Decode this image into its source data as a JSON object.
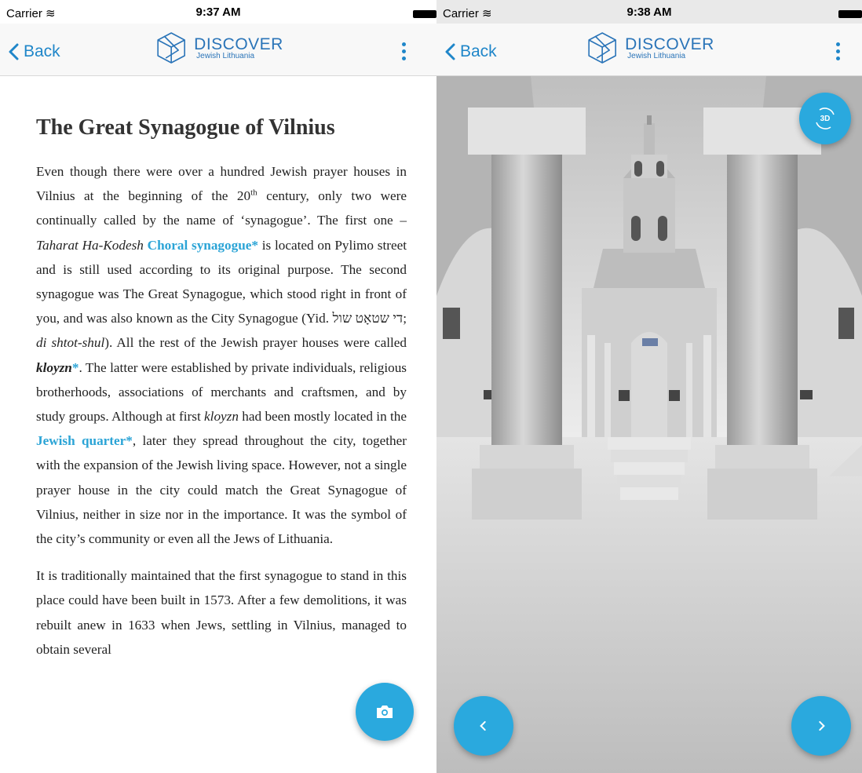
{
  "left": {
    "status": {
      "carrier": "Carrier",
      "time": "9:37 AM"
    },
    "nav": {
      "back_label": "Back",
      "logo_title": "DISCOVER",
      "logo_subtitle": "Jewish Lithuania"
    },
    "article": {
      "title": "The Great Synagogue of Vilnius",
      "p1": {
        "s1": "Even though there were over a hundred Jewish prayer houses in Vilnius at the beginning of the 20",
        "sup": "th",
        "s2": " century, only two were continually called by the name of ‘synagogue’. The first one – ",
        "italic1": "Taharat Ha-Kodesh",
        "link1": "Choral synagogue*",
        "s3": " is located on Pylimo street and is still used according to its original purpose. The second synagogue was The Great Synagogue, which stood right in front of you, and was also known as the City Synagogue (Yid. ",
        "hebrew": "די שטאָט שול",
        "s4": "; ",
        "italic2": "di shtot-shul",
        "s5": "). All the rest of the Jewish prayer houses were called ",
        "bold_italic": "kloyzn",
        "link2": "*",
        "s6": ". The latter were established by private individuals, religious brotherhoods, associations of merchants and craftsmen, and by study groups. Although at first ",
        "italic3": "kloyzn",
        "s7": " had been mostly located in the ",
        "link3": "Jewish quarter*",
        "s8": ", later they spread throughout the city, together with the expansion of the Jewish living space. However, not a single prayer house in the city could match the Great Synagogue of Vilnius, neither in size nor in the importance. It was the symbol of the city’s community or even all the Jews of Lithuania."
      },
      "p2": "It is traditionally maintained that the first synagogue to stand in this place could have been built in 1573. After a few demolitions, it was rebuilt anew in 1633 when Jews, settling in Vilnius, managed to obtain several"
    },
    "camera_icon": "camera-icon"
  },
  "right": {
    "status": {
      "carrier": "Carrier",
      "time": "9:38 AM"
    },
    "nav": {
      "back_label": "Back",
      "logo_title": "DISCOVER",
      "logo_subtitle": "Jewish Lithuania"
    },
    "view3d_label": "3D",
    "prev_icon": "chevron-left-icon",
    "next_icon": "chevron-right-icon"
  },
  "colors": {
    "accent": "#2aa9de",
    "link": "#2ba4d6",
    "nav_blue": "#1f86c9"
  }
}
